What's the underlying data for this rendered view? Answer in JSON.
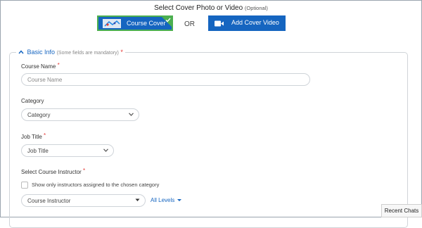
{
  "cover": {
    "title": "Select Cover Photo or Video",
    "optional": "(Optional)",
    "course_cover_label": "Course Cover",
    "or_text": "OR",
    "add_video_label": "Add Cover Video"
  },
  "section": {
    "title": "Basic Info",
    "hint": "(Some fields are mandatory)",
    "required_mark": "*"
  },
  "fields": {
    "course_name": {
      "label": "Course Name",
      "placeholder": "Course Name",
      "required": "*"
    },
    "category": {
      "label": "Category",
      "value": "Category"
    },
    "job_title": {
      "label": "Job Title",
      "value": "Job Title",
      "required": "*"
    },
    "instructor": {
      "label": "Select Course Instructor",
      "required": "*",
      "checkbox_label": "Show only instructors assigned to the chosen category",
      "value": "Course Instructor",
      "levels_label": "All Levels"
    }
  },
  "recent_chats": "Recent Chats",
  "colors": {
    "primary": "#1565c0",
    "selected_border": "#4caf50",
    "required": "#e53935"
  }
}
